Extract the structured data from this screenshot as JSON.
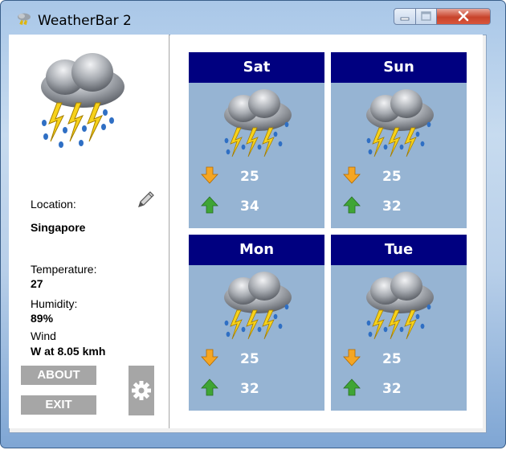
{
  "window": {
    "title": "WeatherBar 2"
  },
  "current": {
    "location_label": "Location:",
    "location_value": "Singapore",
    "temperature_label": "Temperature:",
    "temperature_value": "27",
    "humidity_label": "Humidity:",
    "humidity_value": "89%",
    "wind_label": "Wind",
    "wind_value": "W at 8.05 kmh",
    "condition_icon": "thunderstorm-icon"
  },
  "buttons": {
    "about": "ABOUT",
    "exit": "EXIT",
    "settings_icon": "gear-icon"
  },
  "forecast": [
    {
      "day": "Sat",
      "low": "25",
      "high": "34",
      "icon": "thunderstorm-icon"
    },
    {
      "day": "Sun",
      "low": "25",
      "high": "32",
      "icon": "thunderstorm-icon"
    },
    {
      "day": "Mon",
      "low": "25",
      "high": "32",
      "icon": "thunderstorm-icon"
    },
    {
      "day": "Tue",
      "low": "25",
      "high": "32",
      "icon": "thunderstorm-icon"
    }
  ],
  "colors": {
    "card_header": "#000080",
    "card_body": "#96b4d3",
    "button_gray": "#a6a6a6",
    "low_arrow": "#f5a623",
    "high_arrow": "#3fa535"
  }
}
